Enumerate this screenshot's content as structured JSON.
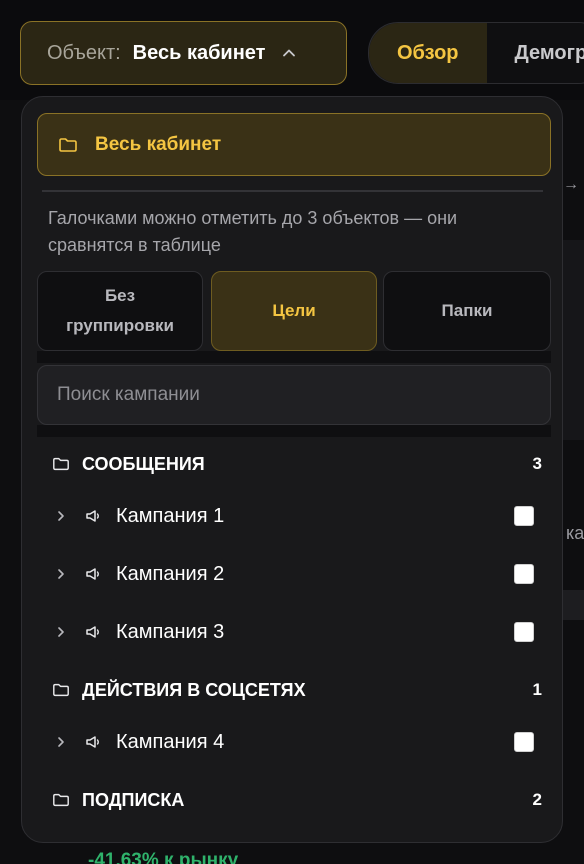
{
  "top_bar": {
    "object_label": "Объект:",
    "object_value": "Весь кабинет",
    "tabs": [
      {
        "label": "Обзор",
        "active": true
      },
      {
        "label": "Демогр",
        "active": false
      }
    ]
  },
  "background": {
    "arrow_glyph": "→",
    "partial_text": "ка",
    "partial_metric": "-41,63% к рынку"
  },
  "dropdown": {
    "all_cabinet": "Весь кабинет",
    "hint": "Галочками можно отметить до 3 объектов — они сравнятся в таблице",
    "grouping": [
      {
        "label": "Без группировки",
        "active": false
      },
      {
        "label": "Цели",
        "active": true
      },
      {
        "label": "Папки",
        "active": false
      }
    ],
    "search_placeholder": "Поиск кампании",
    "groups": [
      {
        "title": "СООБЩЕНИЯ",
        "count": "3",
        "campaigns": [
          {
            "name": "Кампания 1",
            "checked": false
          },
          {
            "name": "Кампания 2",
            "checked": false
          },
          {
            "name": "Кампания 3",
            "checked": false
          }
        ]
      },
      {
        "title": "ДЕЙСТВИЯ В СОЦСЕТЯХ",
        "count": "1",
        "campaigns": [
          {
            "name": "Кампания 4",
            "checked": false
          }
        ]
      },
      {
        "title": "ПОДПИСКА",
        "count": "2",
        "campaigns": []
      }
    ]
  },
  "colors": {
    "accent": "#f4c542",
    "accent_bg": "#3a3116",
    "panel_bg": "#19191b",
    "page_bg": "#0b0b0d",
    "positive": "#2fb26b"
  },
  "icons": {
    "folder": "folder-icon",
    "chevron_up": "chevron-up-icon",
    "chevron_right": "chevron-right-icon",
    "megaphone": "megaphone-icon"
  }
}
